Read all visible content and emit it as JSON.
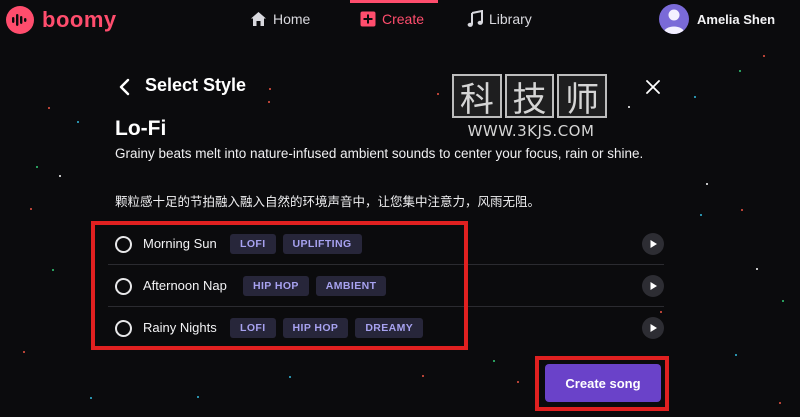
{
  "brand": {
    "name": "boomy",
    "color": "#ff4d6d"
  },
  "nav": {
    "home": "Home",
    "create": "Create",
    "library": "Library"
  },
  "user": {
    "name": "Amelia Shen"
  },
  "modal": {
    "title": "Select Style",
    "style_name": "Lo-Fi",
    "description_en": "Grainy beats melt into nature-infused ambient sounds to center your focus, rain or shine.",
    "description_zh": "颗粒感十足的节拍融入融入自然的环境声音中，让您集中注意力，风雨无阻。"
  },
  "watermark": {
    "chars": [
      "科",
      "技",
      "师"
    ],
    "url": "WWW.3KJS.COM"
  },
  "songs": [
    {
      "name": "Morning Sun",
      "tags": [
        "LOFI",
        "UPLIFTING"
      ]
    },
    {
      "name": "Afternoon Nap",
      "tags": [
        "HIP HOP",
        "AMBIENT"
      ]
    },
    {
      "name": "Rainy Nights",
      "tags": [
        "LOFI",
        "HIP HOP",
        "DREAMY"
      ]
    }
  ],
  "actions": {
    "create_song": "Create song"
  },
  "colors": {
    "accent": "#6a42c9",
    "tag_bg": "#27263a",
    "tag_text": "#a7a2f0",
    "highlight": "#e02020"
  }
}
